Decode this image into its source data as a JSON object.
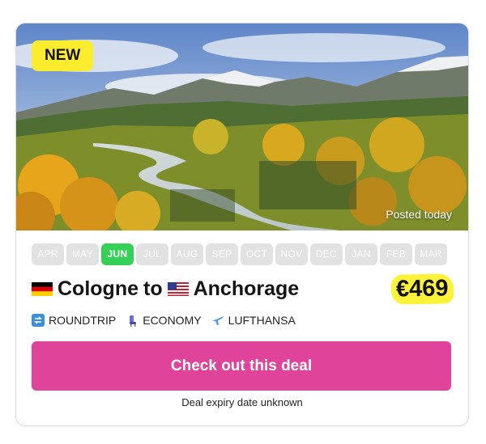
{
  "card": {
    "badge": "NEW",
    "posted": "Posted today",
    "months": [
      "APR",
      "MAY",
      "JUN",
      "JUL",
      "AUG",
      "SEP",
      "OCT",
      "NOV",
      "DEC",
      "JAN",
      "FEB",
      "MAR"
    ],
    "active_month": "JUN",
    "origin": "Cologne",
    "connector": "to",
    "destination": "Anchorage",
    "price": "€469",
    "meta": {
      "trip_type": "ROUNDTRIP",
      "cabin": "ECONOMY",
      "airline": "LUFTHANSA"
    },
    "cta_label": "Check out this deal",
    "expiry": "Deal expiry date unknown"
  },
  "colors": {
    "badge_bg": "#fcec2e",
    "active_month": "#34d058",
    "inactive_month": "#e2e2e2",
    "cta": "#e0449a",
    "price_highlight": "#fcf23a"
  },
  "icons": {
    "origin_flag": "germany-flag-icon",
    "destination_flag": "usa-flag-icon",
    "trip_type": "repeat-icon",
    "cabin": "seat-icon",
    "airline": "airplane-icon"
  }
}
